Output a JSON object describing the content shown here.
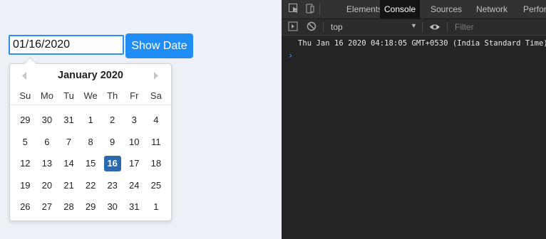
{
  "form": {
    "date_value": "01/16/2020",
    "show_button_label": "Show Date"
  },
  "calendar": {
    "month_title": "January 2020",
    "prev_icon": "chevron-left-icon",
    "next_icon": "chevron-right-icon",
    "weekdays": [
      "Su",
      "Mo",
      "Tu",
      "We",
      "Th",
      "Fr",
      "Sa"
    ],
    "selected_day": "16",
    "selected_color": "#2c68ad",
    "weeks": [
      [
        "29",
        "30",
        "31",
        "1",
        "2",
        "3",
        "4"
      ],
      [
        "5",
        "6",
        "7",
        "8",
        "9",
        "10",
        "11"
      ],
      [
        "12",
        "13",
        "14",
        "15",
        "16",
        "17",
        "18"
      ],
      [
        "19",
        "20",
        "21",
        "22",
        "23",
        "24",
        "25"
      ],
      [
        "26",
        "27",
        "28",
        "29",
        "30",
        "31",
        "1"
      ]
    ]
  },
  "devtools": {
    "tabs": [
      "Elements",
      "Console",
      "Sources",
      "Network",
      "Perfor"
    ],
    "active_tab": "Console",
    "context": "top",
    "filter_placeholder": "Filter",
    "log_output": "Thu Jan 16 2020 04:18:05 GMT+0530 (India Standard Time)",
    "prompt_symbol": "›",
    "icons": [
      "inspect-element-icon",
      "device-toolbar-icon",
      "sidebar-toggle-icon",
      "clear-console-icon",
      "eye-icon",
      "dropdown-caret-icon"
    ]
  }
}
